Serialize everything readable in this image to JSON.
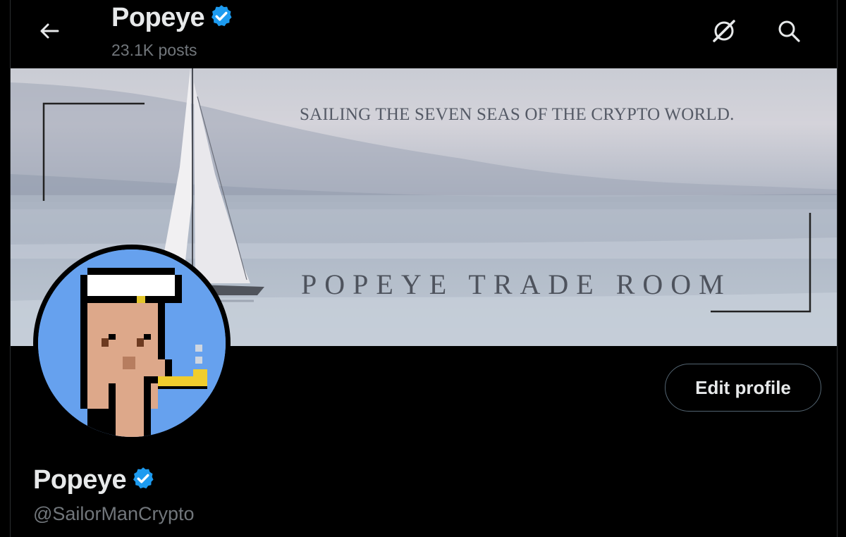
{
  "header": {
    "back_icon": "arrow-left-icon",
    "title": "Popeye",
    "verified_icon": "verified-badge-icon",
    "posts_count": "23.1K posts",
    "grok_icon": "grok-icon",
    "search_icon": "search-icon"
  },
  "banner": {
    "tagline": "SAILING THE SEVEN SEAS OF THE CRYPTO WORLD.",
    "brand": "POPEYE TRADE ROOM"
  },
  "profile": {
    "avatar_icon": "pixel-sailor-avatar",
    "edit_button_label": "Edit profile",
    "display_name": "Popeye",
    "handle": "@SailorManCrypto"
  },
  "colors": {
    "background": "#000000",
    "text_primary": "#e7e9ea",
    "text_secondary": "#71767b",
    "verified_blue": "#1d9bf0",
    "avatar_bg": "#66a1ee"
  }
}
